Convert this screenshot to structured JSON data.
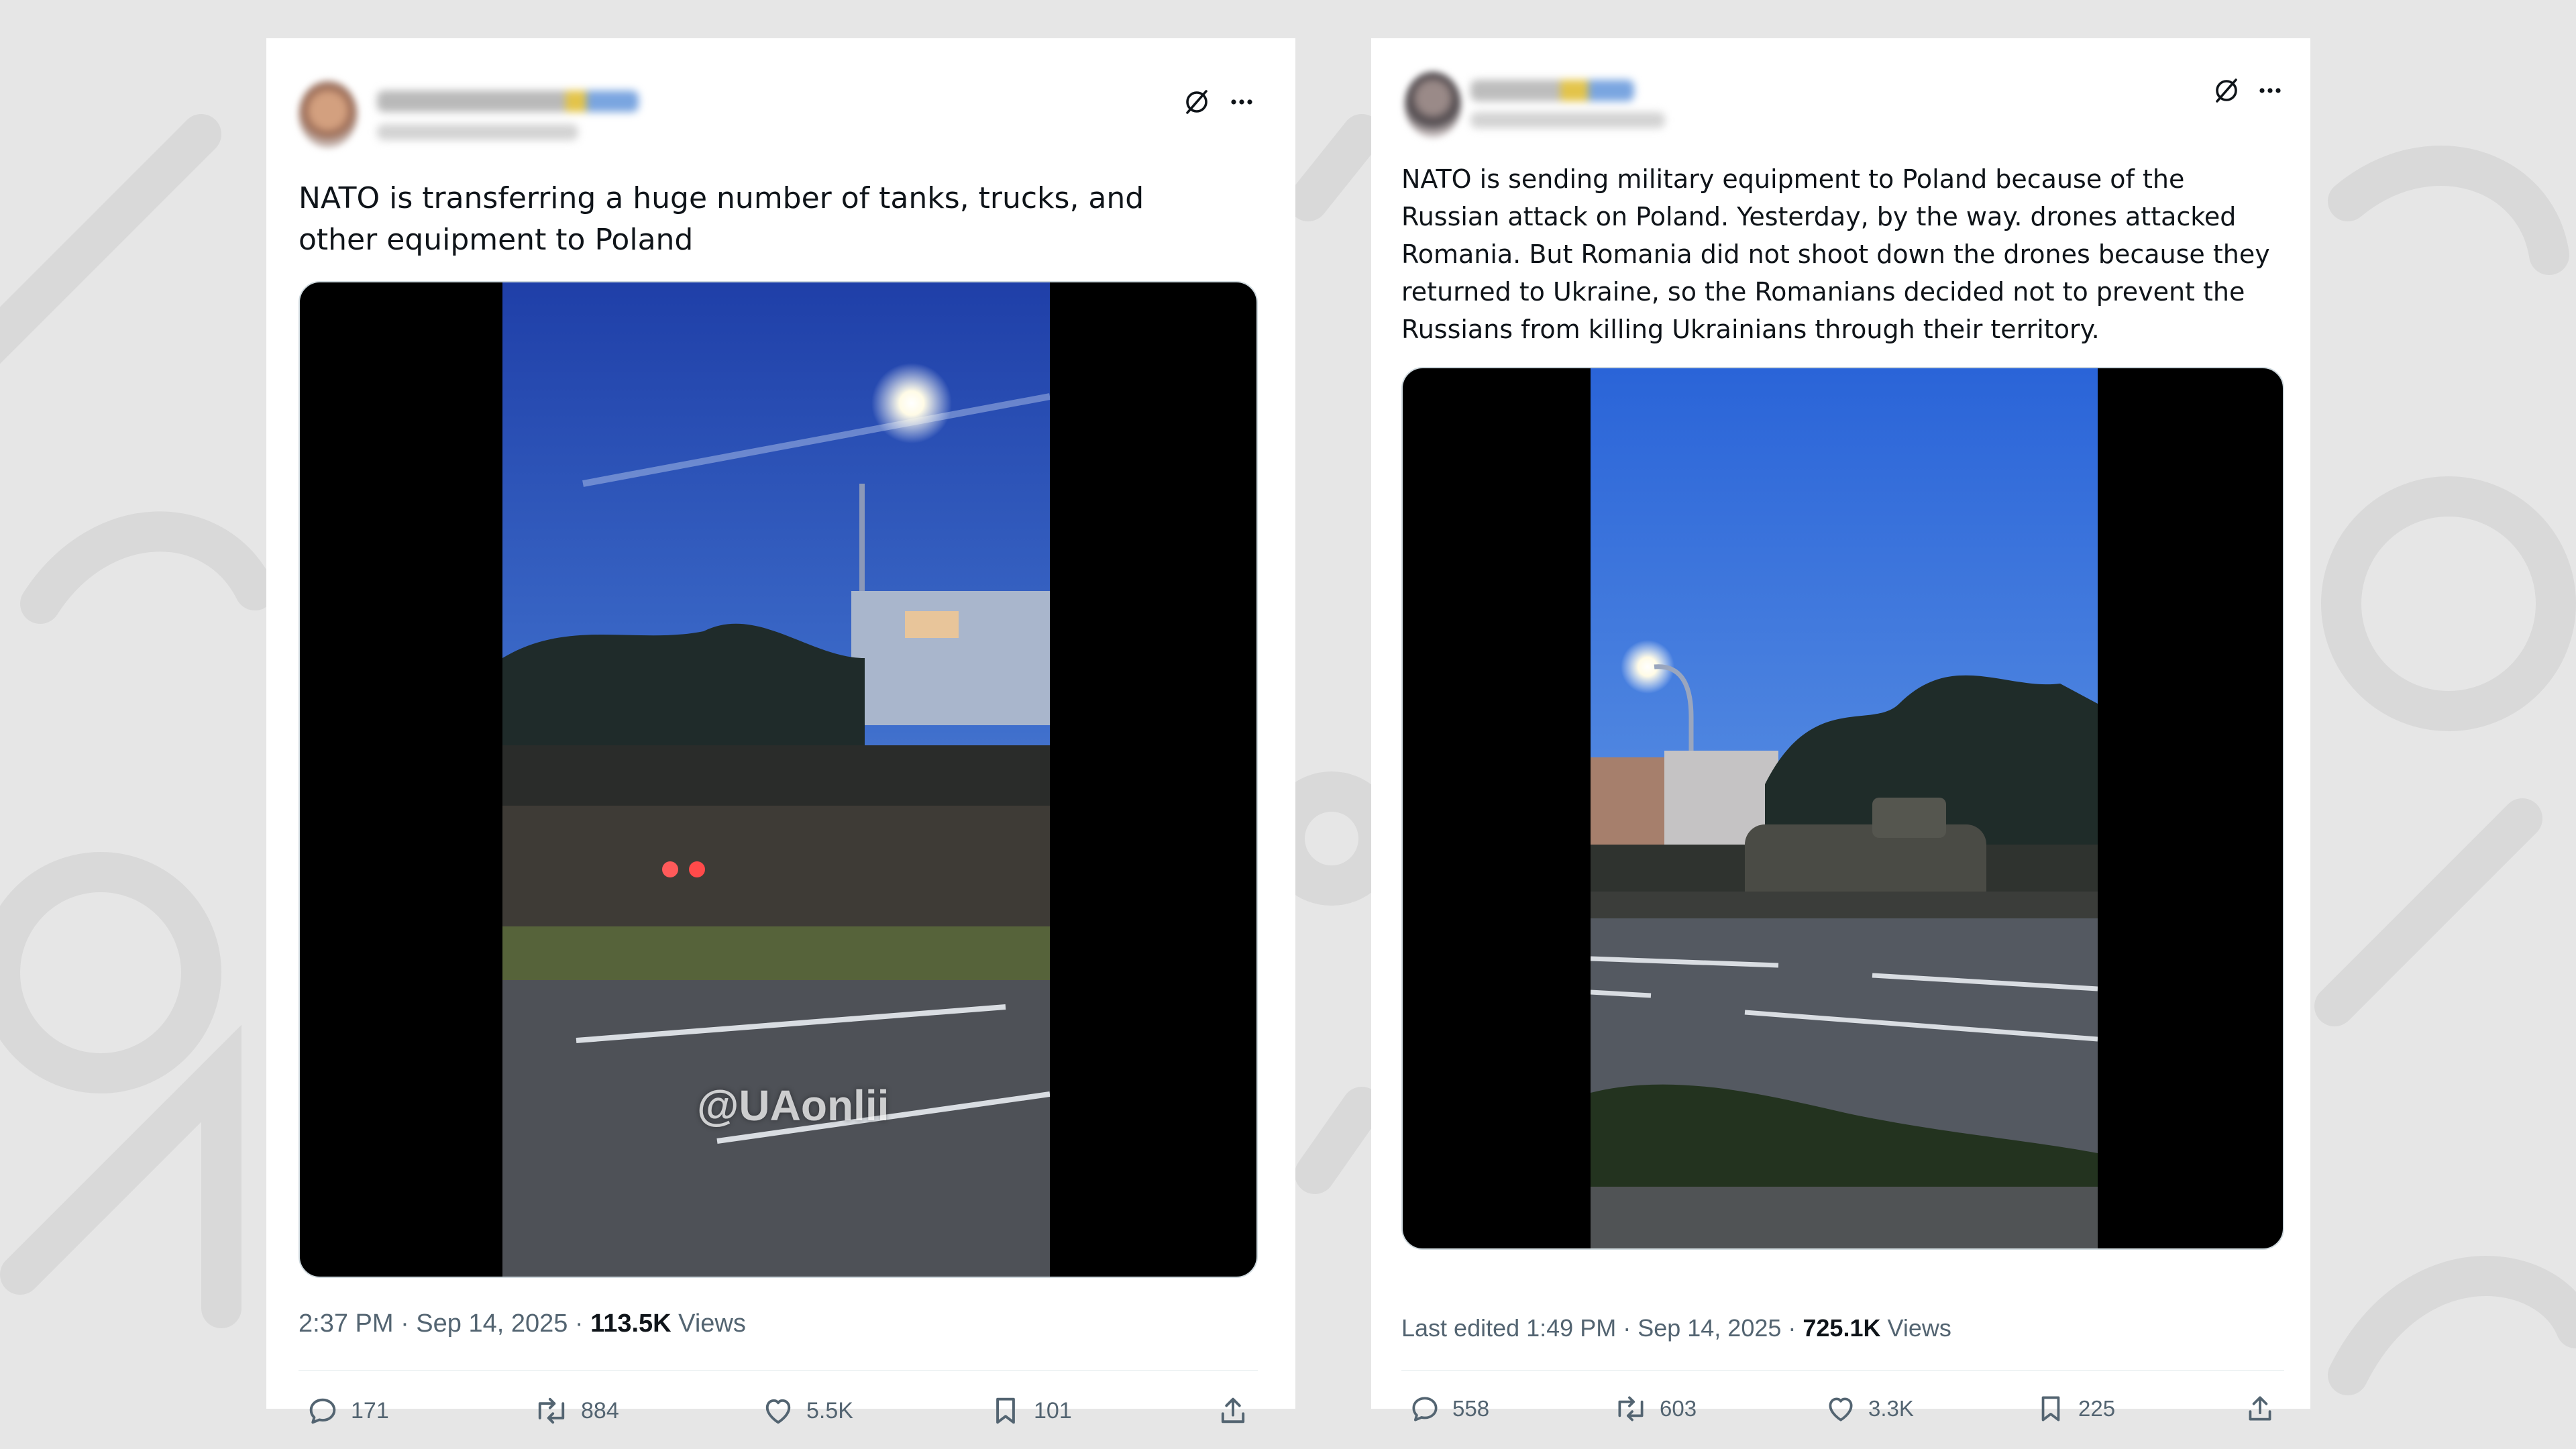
{
  "background": {
    "color": "#e6e6e6"
  },
  "posts": [
    {
      "text": "NATO is transferring a huge number of tanks, trucks, and other equipment to Poland",
      "video_handle": "@UAonlii",
      "meta": {
        "time_date": "2:37 PM · Sep 14, 2025 · ",
        "views_count": "113.5K",
        "views_label": " Views"
      },
      "actions": {
        "replies": "171",
        "reposts": "884",
        "likes": "5.5K",
        "bookmarks": "101"
      }
    },
    {
      "text": "NATO is sending military equipment to Poland because of the Russian attack on Poland. Yesterday, by the way. drones attacked Romania. But Romania did not shoot down the drones because they returned to Ukraine, so the Romanians decided not to prevent the Russians from killing Ukrainians through their territory.",
      "meta": {
        "time_date": "Last edited 1:49 PM · Sep 14, 2025 · ",
        "views_count": "725.1K",
        "views_label": " Views"
      },
      "actions": {
        "replies": "558",
        "reposts": "603",
        "likes": "3.3K",
        "bookmarks": "225"
      }
    }
  ],
  "icons": {
    "header": [
      "grok-icon",
      "more-icon"
    ],
    "actions": [
      "reply-icon",
      "repost-icon",
      "like-icon",
      "bookmark-icon",
      "share-icon"
    ]
  },
  "colors": {
    "text": "#0f1419",
    "secondary": "#536471",
    "card": "#ffffff",
    "media_bg": "#000000"
  }
}
